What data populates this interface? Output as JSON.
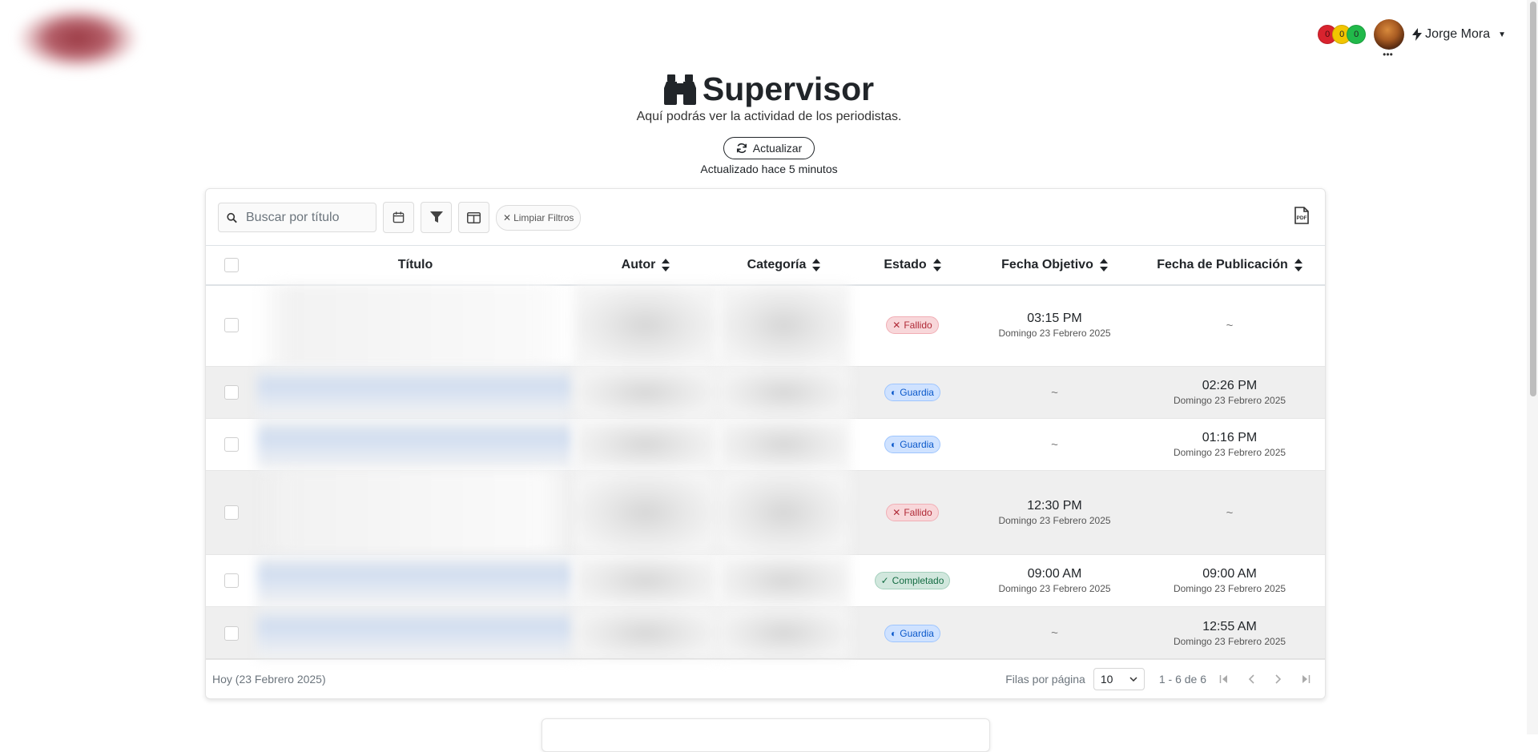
{
  "header": {
    "title": "Supervisor",
    "subtitle": "Aquí podrás ver la actividad de los periodistas.",
    "refresh_label": "Actualizar",
    "updated_text": "Actualizado hace 5 minutos"
  },
  "user": {
    "name": "Jorge Mora",
    "lights": [
      "0",
      "0",
      "0"
    ]
  },
  "toolbar": {
    "search_placeholder": "Buscar por título",
    "clear_filters": "Limpiar Filtros"
  },
  "table": {
    "columns": [
      "Título",
      "Autor",
      "Categoría",
      "Estado",
      "Fecha Objetivo",
      "Fecha de Publicación"
    ],
    "rows": [
      {
        "estado": "Fallido",
        "fecha_objetivo_time": "03:15 PM",
        "fecha_objetivo_date": "Domingo 23 Febrero 2025",
        "fecha_pub": "~"
      },
      {
        "estado": "Guardia",
        "fecha_objetivo": "~",
        "fecha_pub_time": "02:26 PM",
        "fecha_pub_date": "Domingo 23 Febrero 2025"
      },
      {
        "estado": "Guardia",
        "fecha_objetivo": "~",
        "fecha_pub_time": "01:16 PM",
        "fecha_pub_date": "Domingo 23 Febrero 2025"
      },
      {
        "estado": "Fallido",
        "fecha_objetivo_time": "12:30 PM",
        "fecha_objetivo_date": "Domingo 23 Febrero 2025",
        "fecha_pub": "~"
      },
      {
        "estado": "Completado",
        "fecha_objetivo_time": "09:00 AM",
        "fecha_objetivo_date": "Domingo 23 Febrero 2025",
        "fecha_pub_time": "09:00 AM",
        "fecha_pub_date": "Domingo 23 Febrero 2025"
      },
      {
        "estado": "Guardia",
        "fecha_objetivo": "~",
        "fecha_pub_time": "12:55 AM",
        "fecha_pub_date": "Domingo 23 Febrero 2025"
      }
    ]
  },
  "footer": {
    "today": "Hoy (23 Febrero 2025)",
    "rows_per_page_label": "Filas por página",
    "rows_per_page_value": "10",
    "range": "1 - 6 de 6"
  },
  "colors": {
    "fallido": "#b02a37",
    "guardia": "#0a58ca",
    "completado": "#146c43",
    "light_red": "#d9232e",
    "light_yellow": "#f2c500",
    "light_green": "#21b94a"
  },
  "icons": {
    "title_icon": "binoculars-icon",
    "refresh_icon": "refresh-icon",
    "user_icon": "bolt-icon",
    "pdf_icon": "file-pdf-icon"
  }
}
